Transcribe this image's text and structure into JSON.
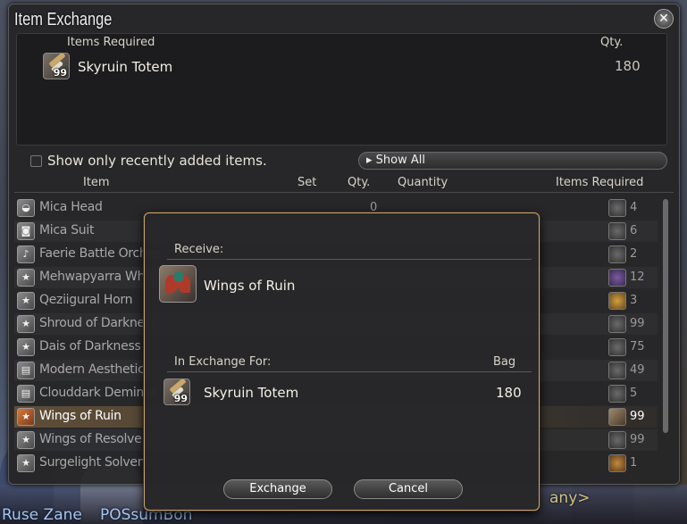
{
  "window": {
    "title": "Item Exchange",
    "close_icon": "close-crossed-swords-icon"
  },
  "requirements": {
    "header_items": "Items Required",
    "header_qty": "Qty.",
    "item_name": "Skyruin Totem",
    "item_badge": "99",
    "item_qty": "180"
  },
  "filter": {
    "checkbox_label": "Show only recently added items.",
    "show_all_label": "Show All"
  },
  "columns": {
    "item": "Item",
    "set": "Set",
    "qty": "Qty.",
    "quantity": "Quantity",
    "items_required": "Items Required"
  },
  "rows": [
    {
      "name": "Mica Head",
      "qty": "0",
      "req": "4"
    },
    {
      "name": "Mica Suit",
      "qty": "",
      "req": "6"
    },
    {
      "name": "Faerie Battle Orches",
      "qty": "",
      "req": "2"
    },
    {
      "name": "Mehwapyarra Whis",
      "qty": "",
      "req": "12"
    },
    {
      "name": "Qeziigural Horn",
      "qty": "",
      "req": "3"
    },
    {
      "name": "Shroud of Darkness",
      "qty": "",
      "req": "99"
    },
    {
      "name": "Dais of Darkness",
      "qty": "",
      "req": "75"
    },
    {
      "name": "Modern Aesthetics -",
      "qty": "",
      "req": "49"
    },
    {
      "name": "Clouddark Demima",
      "qty": "",
      "req": "5"
    },
    {
      "name": "Wings of Ruin",
      "qty": "",
      "req": "99"
    },
    {
      "name": "Wings of Resolve",
      "qty": "",
      "req": "99"
    },
    {
      "name": "Surgelight Solvent",
      "qty": "",
      "req": "1"
    }
  ],
  "dialog": {
    "receive_label": "Receive:",
    "receive_item": "Wings of Ruin",
    "exchange_label": "In Exchange For:",
    "bag_label": "Bag",
    "exchange_item": "Skyruin Totem",
    "exchange_badge": "99",
    "exchange_qty": "180",
    "exchange_button": "Exchange",
    "cancel_button": "Cancel"
  },
  "background": {
    "text_left": "Ruse Zane",
    "text_mid": "POSsumBon ",
    "text_right": "any>"
  }
}
